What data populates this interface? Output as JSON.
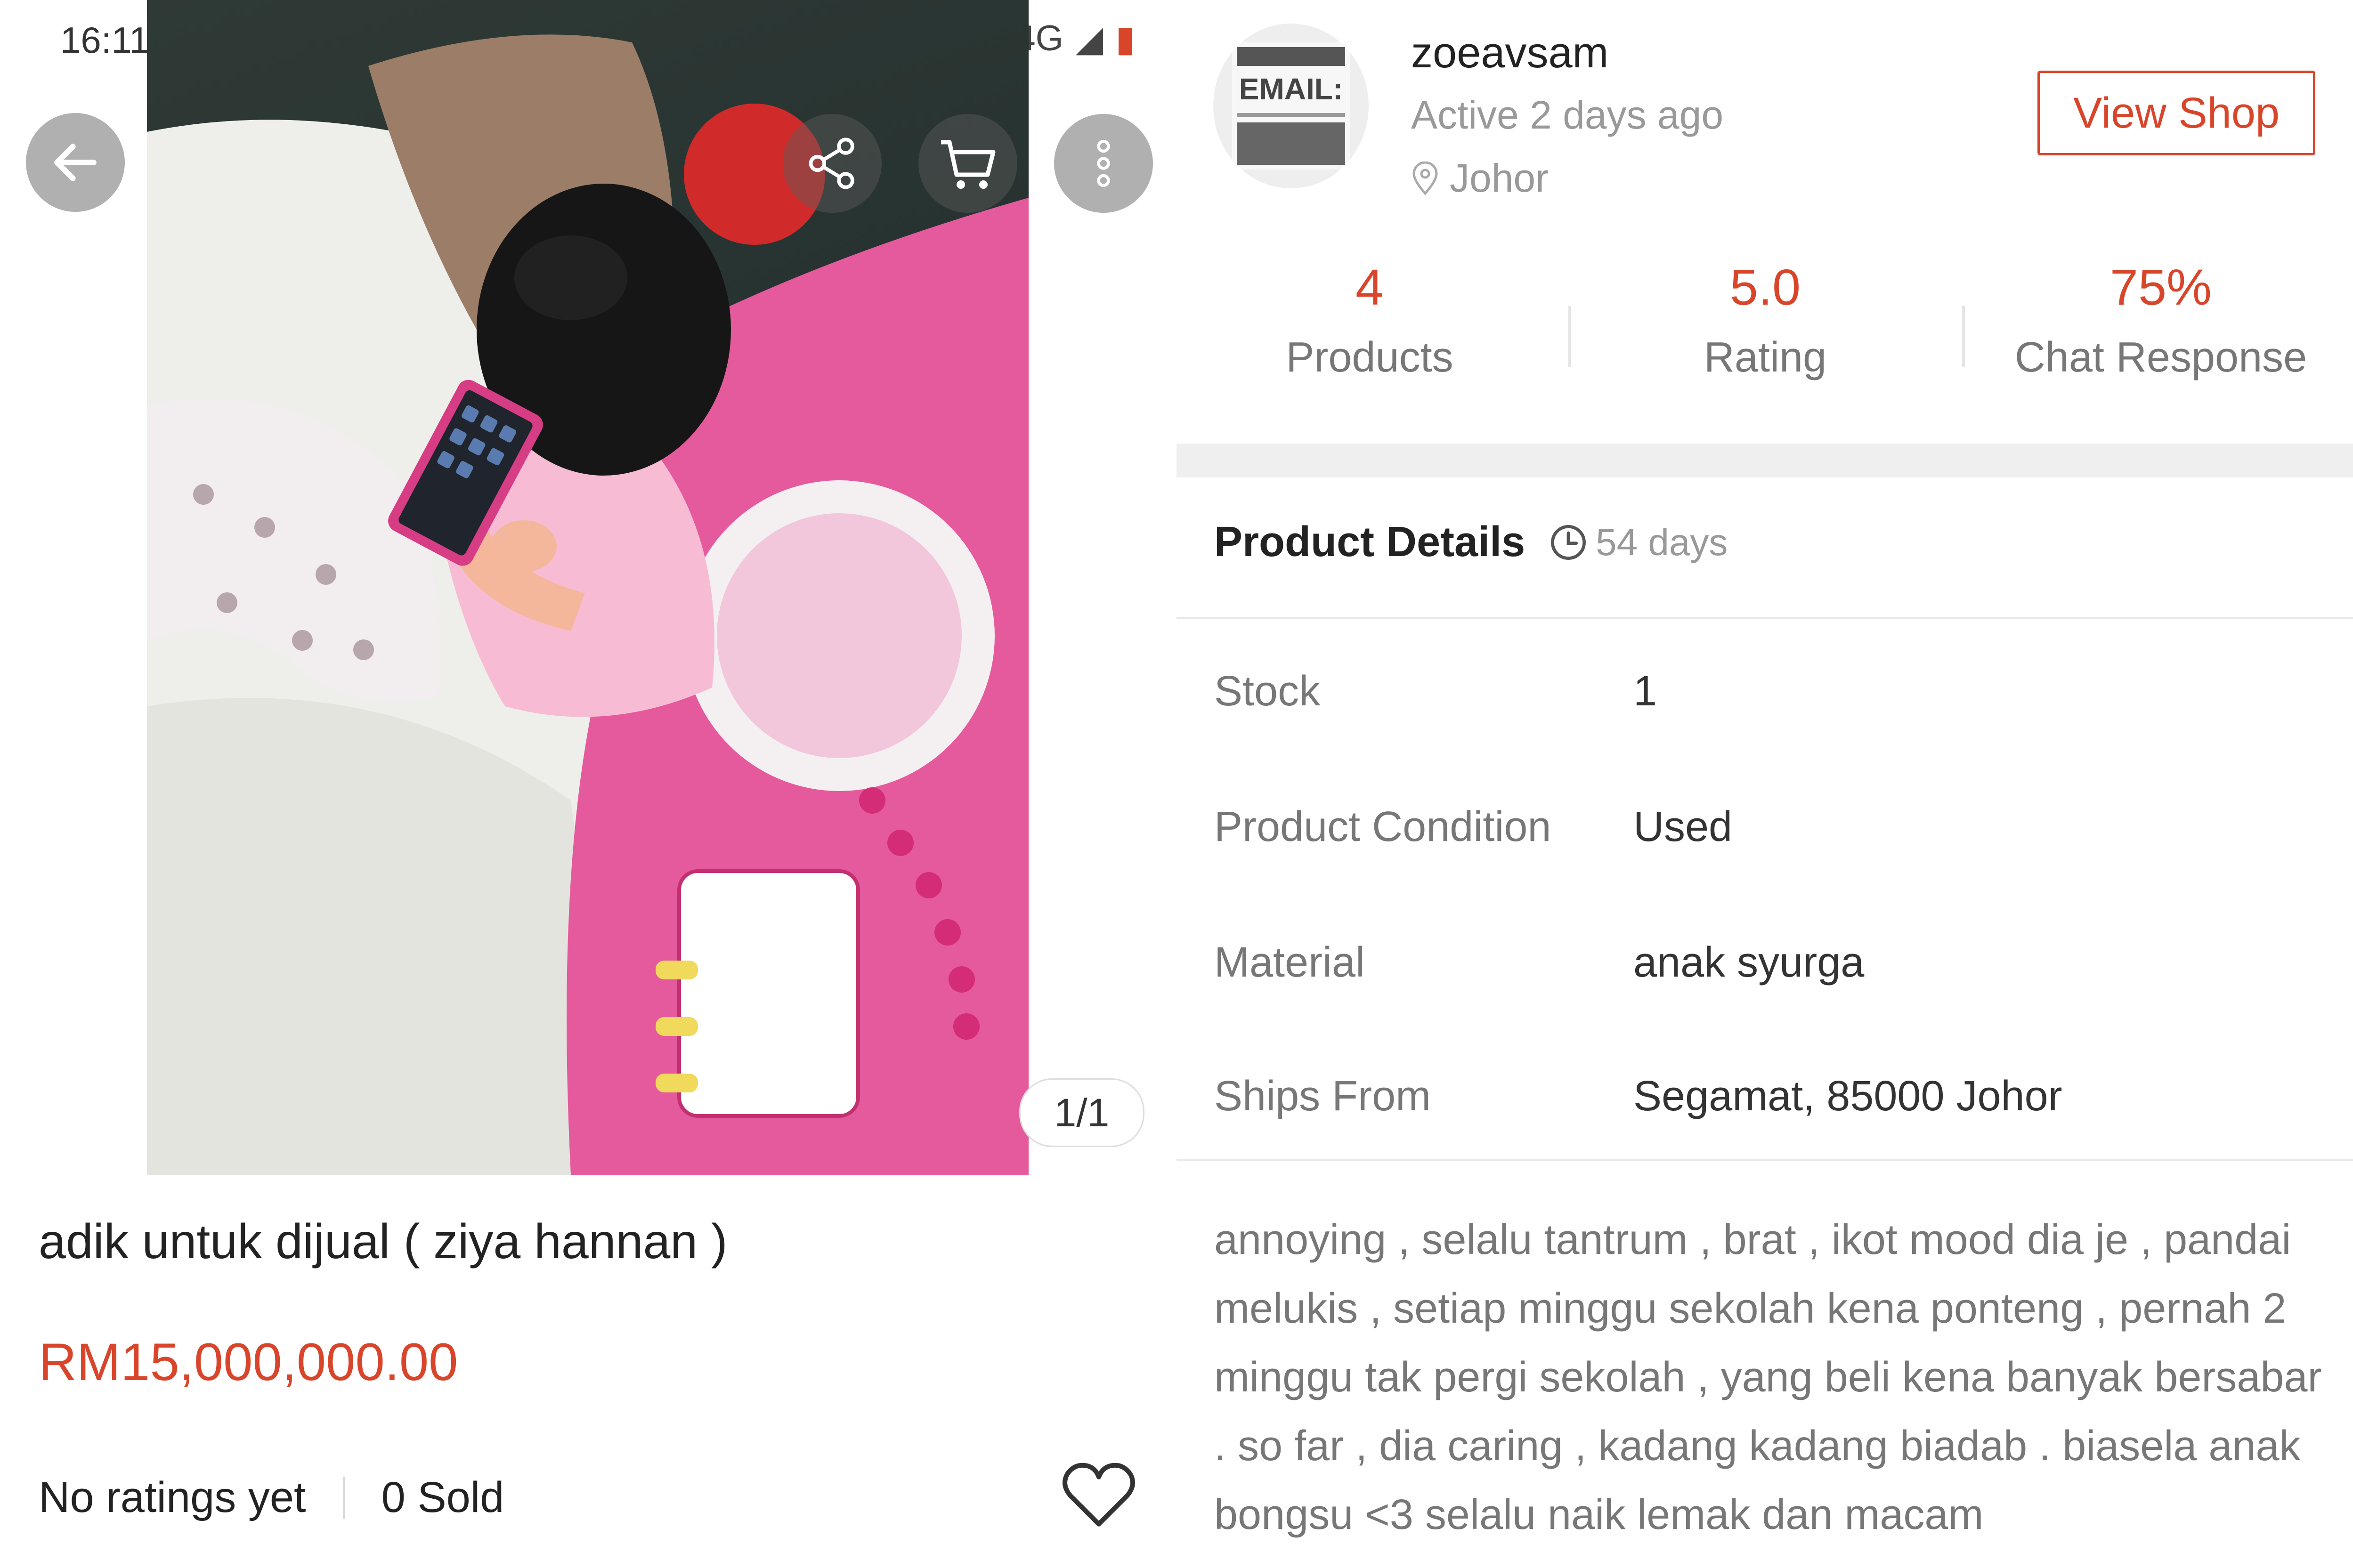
{
  "status_bar": {
    "time": "16:11",
    "network": "4G"
  },
  "gallery": {
    "counter": "1/1"
  },
  "product": {
    "title": "adik untuk dijual ( ziya hannan )",
    "price": "RM15,000,000.00",
    "ratings_text": "No ratings yet",
    "sold_text": "0 Sold"
  },
  "seller": {
    "name": "zoeavsam",
    "active": "Active 2 days ago",
    "location": "Johor",
    "view_shop_label": "View Shop",
    "avatar_text": "EMAIL:"
  },
  "stats": [
    {
      "value": "4",
      "label": "Products"
    },
    {
      "value": "5.0",
      "label": "Rating"
    },
    {
      "value": "75%",
      "label": "Chat Response"
    }
  ],
  "details": {
    "title": "Product Details",
    "age": "54 days",
    "rows": [
      {
        "label": "Stock",
        "value": "1"
      },
      {
        "label": "Product Condition",
        "value": "Used"
      },
      {
        "label": "Material",
        "value": "anak syurga"
      },
      {
        "label": "Ships From",
        "value": "Segamat, 85000 Johor"
      }
    ],
    "description": "annoying , selalu tantrum , brat , ikot mood dia je , pandai melukis , setiap minggu sekolah kena ponteng , pernah 2 minggu tak pergi sekolah , yang beli kena banyak bersabar . so far , dia caring , kadang kadang biadab . biasela anak bongsu <3 selalu naik lemak dan macam"
  },
  "colors": {
    "accent": "#d8452b",
    "muted_text": "#999999",
    "divider": "#e8e8e8"
  },
  "icons": [
    "back-arrow-icon",
    "share-icon",
    "cart-icon",
    "more-vertical-icon",
    "heart-icon",
    "location-pin-icon",
    "clock-icon"
  ]
}
